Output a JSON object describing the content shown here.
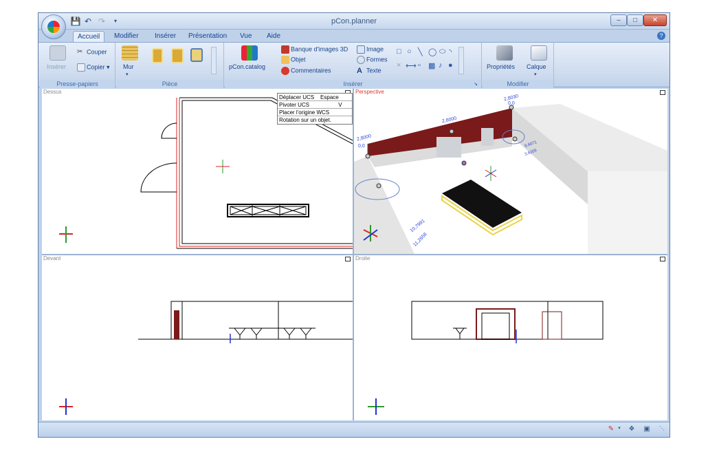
{
  "window": {
    "title": "pCon.planner"
  },
  "quick_access": {
    "save_icon": "save-icon",
    "undo_icon": "undo-icon",
    "redo_icon": "redo-icon"
  },
  "tabs": [
    {
      "label": "Accueil",
      "active": true
    },
    {
      "label": "Modifier"
    },
    {
      "label": "Insérer"
    },
    {
      "label": "Présentation"
    },
    {
      "label": "Vue"
    },
    {
      "label": "Aide"
    }
  ],
  "ribbon": {
    "clipboard": {
      "label": "Presse-papiers",
      "paste": "Insérer",
      "cut": "Couper",
      "copy": "Copier"
    },
    "room": {
      "label": "Pièce",
      "wall": "Mur"
    },
    "insert": {
      "label": "Insérer",
      "catalog": "pCon.catalog",
      "image_bank": "Banque d'images 3D",
      "object": "Objet",
      "comments": "Commentaires",
      "image": "Image",
      "shapes": "Formes",
      "text": "Texte"
    },
    "modify": {
      "label": "Modifier",
      "properties": "Propriétés",
      "layer": "Calque"
    }
  },
  "viewports": {
    "top": {
      "label": "Dessus"
    },
    "perspective": {
      "label": "Perspective",
      "dims": [
        "2,8030",
        "0,0",
        "2,8000",
        "2,8000",
        "0,0",
        "10,7991",
        "11,2658",
        "9,6071",
        "3,6209"
      ]
    },
    "front": {
      "label": "Devant"
    },
    "right": {
      "label": "Droite"
    }
  },
  "context_menu": {
    "items": [
      {
        "label": "Déplacer UCS",
        "extra": "Espace"
      },
      {
        "label": "Pivoter UCS",
        "extra": "V"
      },
      {
        "label": "Placer l'origine WCS",
        "extra": ""
      },
      {
        "label": "Rotation sur un objet.",
        "extra": ""
      }
    ]
  },
  "colors": {
    "wall_red": "#7a1a1a",
    "accent_red": "#e0382a",
    "axis_green": "#2b9a2b",
    "axis_blue": "#2233cc"
  }
}
